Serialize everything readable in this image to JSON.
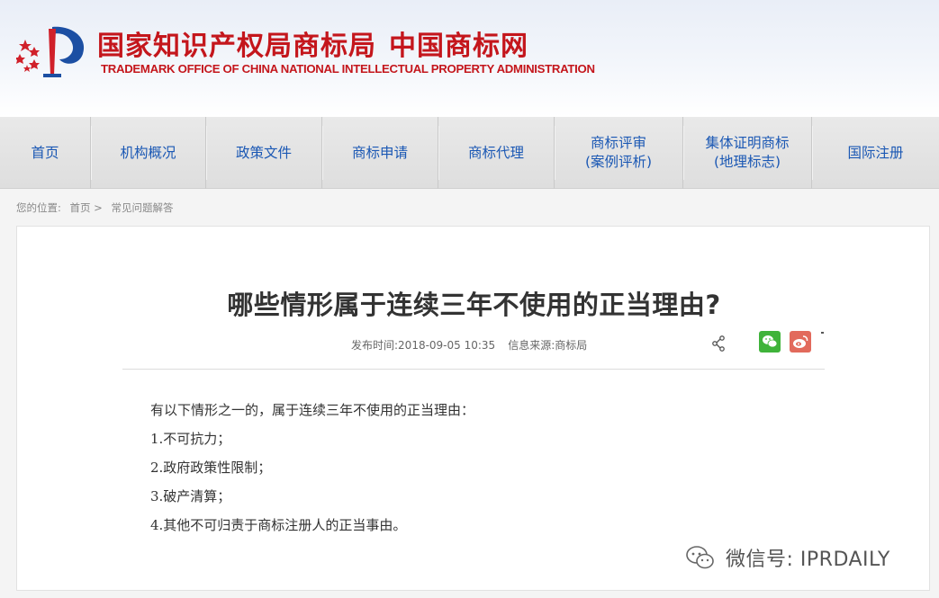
{
  "header": {
    "title_cn": "国家知识产权局商标局",
    "title_cn_site": "中国商标网",
    "title_en": "TRADEMARK OFFICE OF CHINA NATIONAL INTELLECTUAL PROPERTY ADMINISTRATION",
    "logo_icon": "trademark-office-emblem",
    "brand_color": "#c4161c"
  },
  "nav": {
    "items": [
      {
        "label": "首页"
      },
      {
        "label": "机构概况"
      },
      {
        "label": "政策文件"
      },
      {
        "label": "商标申请"
      },
      {
        "label": "商标代理"
      },
      {
        "label_line1": "商标评审",
        "label_line2": "(案例评析)"
      },
      {
        "label_line1": "集体证明商标",
        "label_line2": "(地理标志)"
      },
      {
        "label": "国际注册"
      }
    ],
    "text_color": "#1b58b4"
  },
  "breadcrumb": {
    "prefix": "您的位置:",
    "home": "首页 >",
    "current": "常见问题解答"
  },
  "article": {
    "title": "哪些情形属于连续三年不使用的正当理由?",
    "publish_label": "发布时间:",
    "publish_time": "2018-09-05 10:35",
    "source_label": "信息来源:",
    "source": "商标局",
    "share_icons": [
      "share-icon",
      "wechat-icon",
      "weibo-icon"
    ],
    "paragraphs": [
      "有以下情形之一的，属于连续三年不使用的正当理由：",
      "1.不可抗力；",
      "2.政府政策性限制；",
      "3.破产清算；",
      "4.其他不可归责于商标注册人的正当事由。"
    ]
  },
  "watermark": {
    "icon": "wechat-icon",
    "text": "微信号: IPRDAILY"
  }
}
